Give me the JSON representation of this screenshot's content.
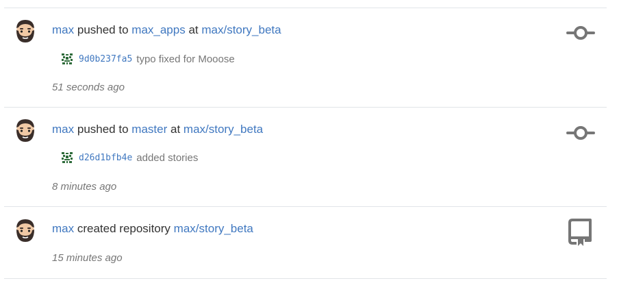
{
  "feed": {
    "events": [
      {
        "actor": "max",
        "action": "pushed to",
        "ref": "max_apps",
        "preposition": "at",
        "repo": "max/story_beta",
        "commit": {
          "sha": "9d0b237fa5",
          "message": "typo fixed for Mooose"
        },
        "time": "51 seconds ago",
        "icon": "commit-icon"
      },
      {
        "actor": "max",
        "action": "pushed to",
        "ref": "master",
        "preposition": "at",
        "repo": "max/story_beta",
        "commit": {
          "sha": "d26d1bfb4e",
          "message": "added stories"
        },
        "time": "8 minutes ago",
        "icon": "commit-icon"
      },
      {
        "actor": "max",
        "action": "created repository",
        "repo": "max/story_beta",
        "time": "15 minutes ago",
        "icon": "repo-icon"
      }
    ]
  },
  "colors": {
    "link": "#4078c0",
    "muted": "#767676",
    "icon": "#767676",
    "divider": "#e1e4e8",
    "identicon": "#2e6b3a"
  }
}
